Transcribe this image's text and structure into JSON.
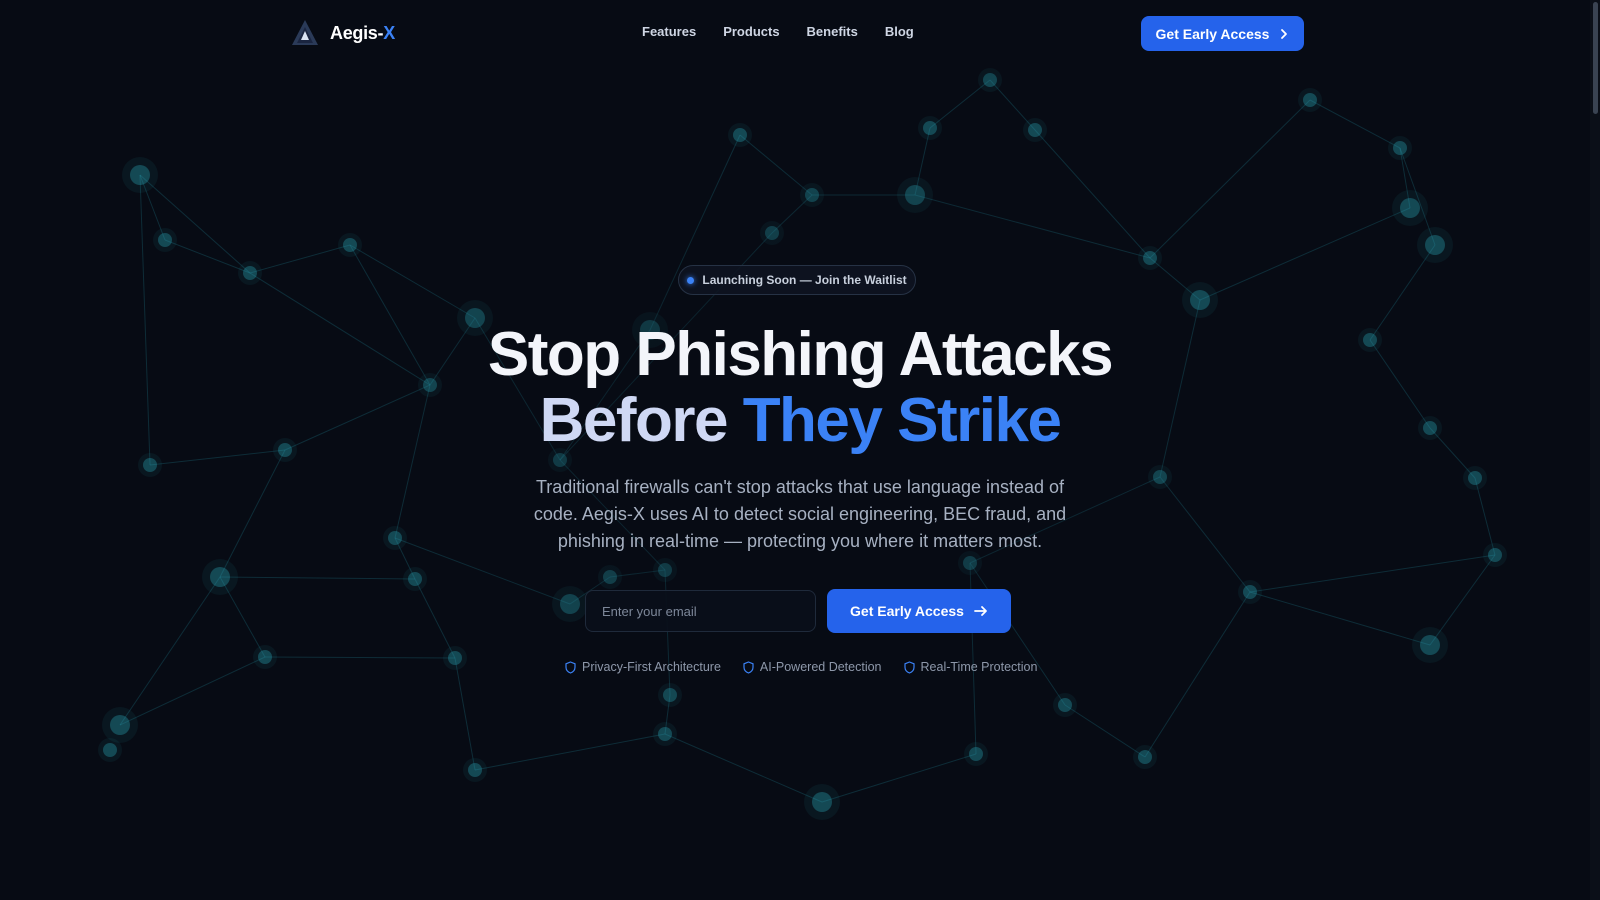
{
  "brand": {
    "name": "Aegis-",
    "suffix": "X",
    "logo_icon": "triangle-logo-icon"
  },
  "nav": {
    "items": [
      "Features",
      "Products",
      "Benefits",
      "Blog"
    ]
  },
  "header": {
    "cta_label": "Get Early Access",
    "cta_icon": "chevron-right-icon"
  },
  "hero": {
    "badge": "Launching Soon — Join the Waitlist",
    "title_line1": "Stop Phishing Attacks",
    "title_before": "Before",
    "title_accent": "They Strike",
    "subtext": "Traditional firewalls can't stop attacks that use language instead of code. Aegis-X uses AI to detect social engineering, BEC fraud, and phishing in real-time — protecting you where it matters most.",
    "email_placeholder": "Enter your email",
    "email_value": "",
    "cta_label": "Get Early Access",
    "cta_icon": "arrow-right-icon",
    "features": [
      "Privacy-First Architecture",
      "AI-Powered Detection",
      "Real-Time Protection"
    ],
    "feature_icon": "shield-icon"
  },
  "colors": {
    "background": "#070b14",
    "accent": "#3b82f6",
    "button": "#2563eb",
    "network": "#2aa6b8"
  }
}
